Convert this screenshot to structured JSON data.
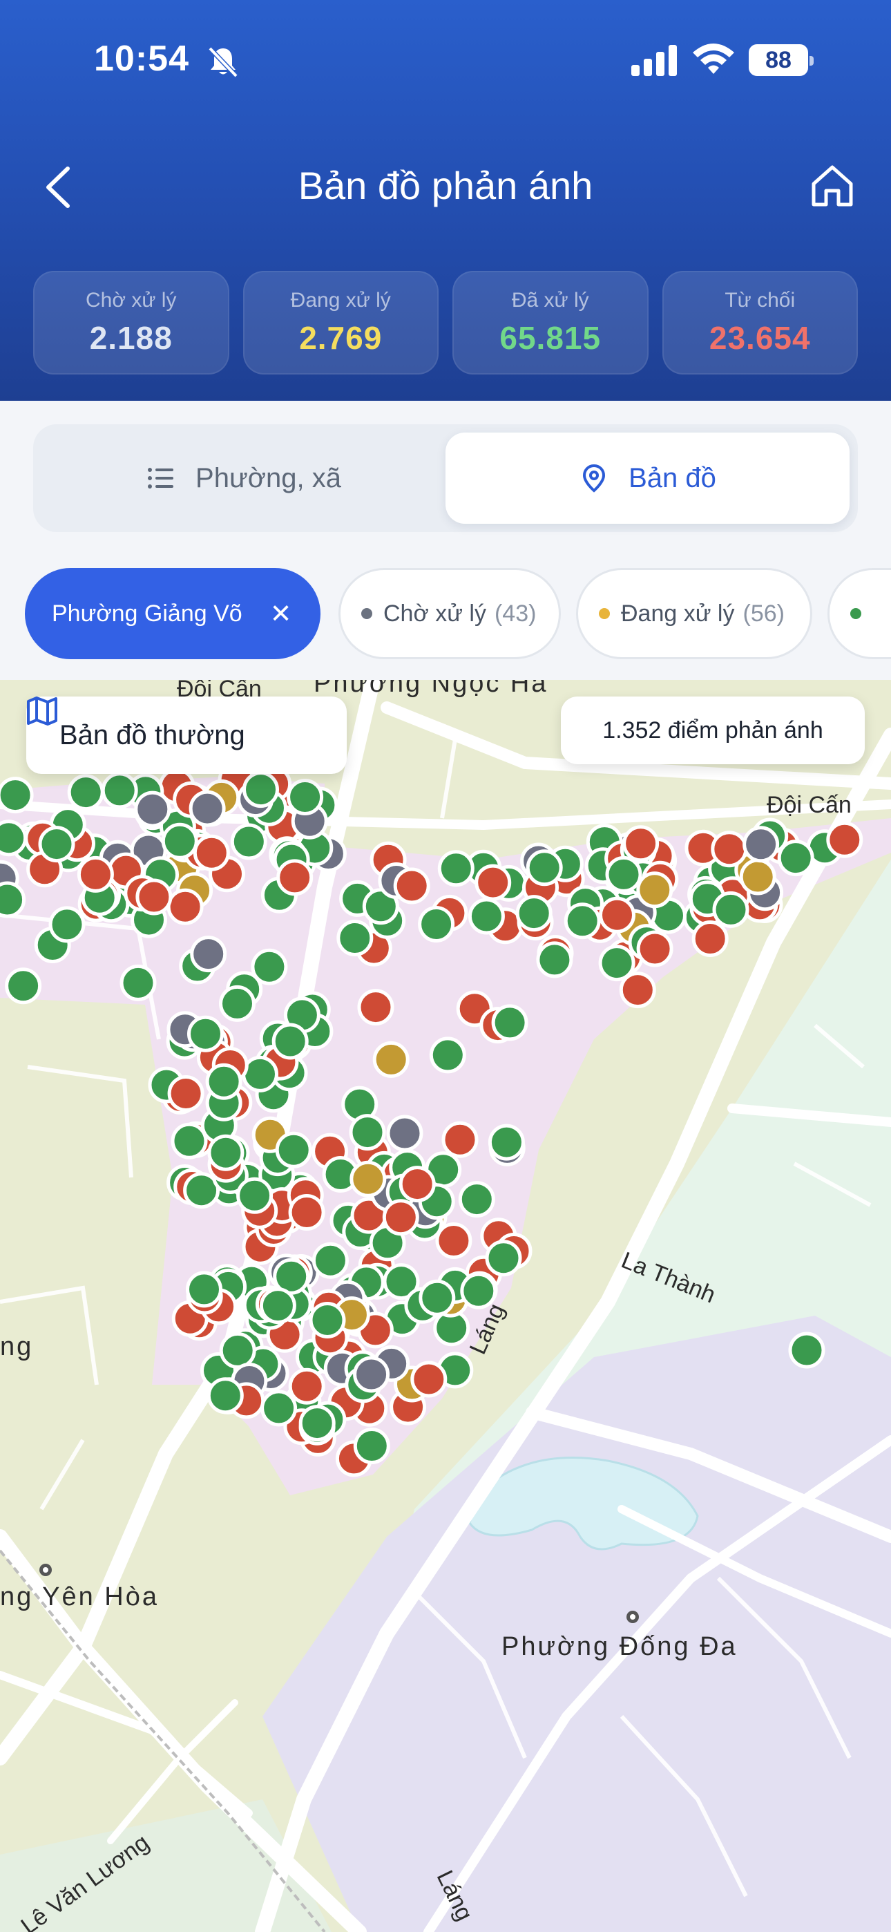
{
  "status_bar": {
    "time": "10:54",
    "battery": "88"
  },
  "nav": {
    "title": "Bản đồ phản ánh"
  },
  "stats": [
    {
      "label": "Chờ xử lý",
      "value": "2.188",
      "color": "#dfe6f3"
    },
    {
      "label": "Đang xử lý",
      "value": "2.769",
      "color": "#f4dd5e"
    },
    {
      "label": "Đã xử lý",
      "value": "65.815",
      "color": "#72d889"
    },
    {
      "label": "Từ chối",
      "value": "23.654",
      "color": "#f0726a"
    }
  ],
  "view_toggle": {
    "list_label": "Phường, xã",
    "map_label": "Bản đồ",
    "active": "map"
  },
  "filters": {
    "active_ward": "Phường Giảng Võ",
    "status_chips": [
      {
        "label": "Chờ xử lý",
        "count": "(43)",
        "color": "#6b7280"
      },
      {
        "label": "Đang xử lý",
        "count": "(56)",
        "color": "#e8b43a"
      }
    ]
  },
  "map": {
    "mode_label": "Bản đồ thường",
    "points_count_label": "1.352 điểm phản ánh",
    "labels": {
      "doi_can_top": "Đội Cấn",
      "ngoc_ha": "Phường Ngọc Hà",
      "doi_can_right": "Đội Cấn",
      "la_thanh": "La Thành",
      "ng_left": "ng",
      "yen_hoa": "ng Yên Hòa",
      "dong_da": "Phường Đống Đa",
      "le_van_luong": "Lê Văn Lương",
      "lang": "Láng",
      "lang_road": "Láng"
    },
    "marker_colors": {
      "done": "#3a9a4e",
      "rejected": "#cf4b35",
      "pending": "#6e7183",
      "processing": "#c39a33"
    }
  }
}
